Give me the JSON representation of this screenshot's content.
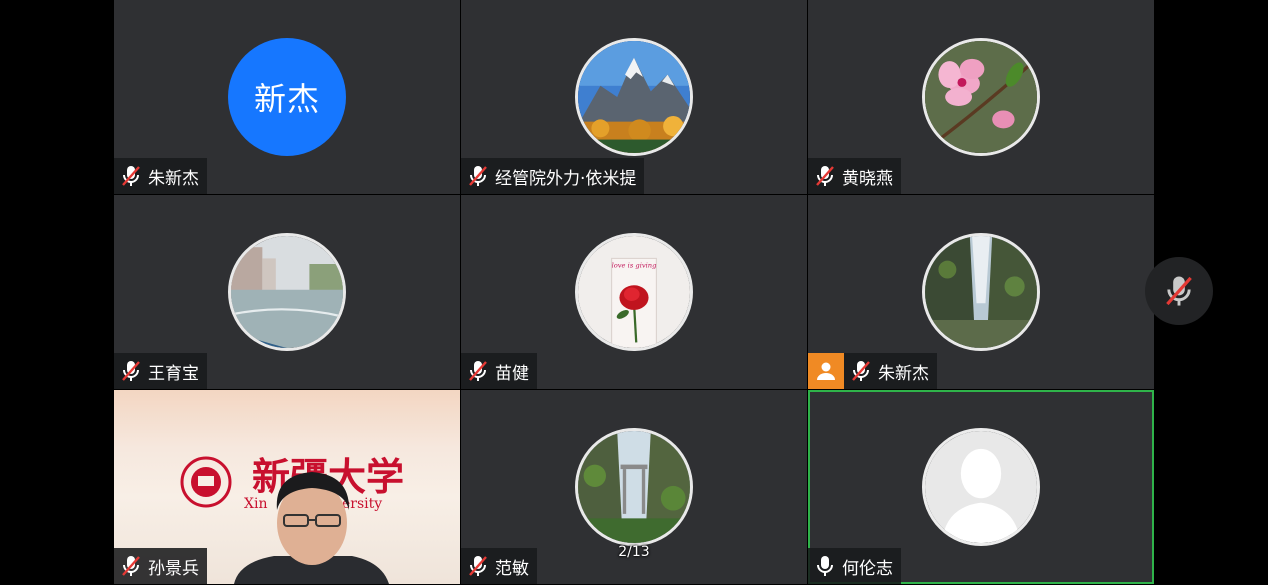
{
  "participants": [
    {
      "name": "朱新杰",
      "avatar_text": "新杰",
      "mic": "muted"
    },
    {
      "name": "经管院外力·依米提",
      "avatar": "mountain-photo",
      "mic": "muted"
    },
    {
      "name": "黄晓燕",
      "avatar": "flower-photo",
      "mic": "muted"
    },
    {
      "name": "王育宝",
      "avatar": "lake-photo",
      "mic": "muted"
    },
    {
      "name": "苗健",
      "avatar": "rose-photo",
      "mic": "muted"
    },
    {
      "name": "朱新杰",
      "avatar": "canyon-photo",
      "mic": "muted",
      "host": true
    },
    {
      "name": "孙景兵",
      "video": true,
      "mic": "muted"
    },
    {
      "name": "范敏",
      "avatar": "cliff-photo",
      "mic": "muted"
    },
    {
      "name": "何伦志",
      "avatar": "default-person",
      "mic": "on",
      "active_speaker": true
    }
  ],
  "video_banner": {
    "logo_text": "新疆大学",
    "english_fragment": "Xin",
    "english_fragment_2": "ersity"
  },
  "rose_text": "love is giving",
  "pagination": {
    "indicator": "2/13"
  },
  "colors": {
    "tile_bg": "#2f3033",
    "avatar_blue": "#1677ff",
    "active_border": "#2fb34a",
    "host_orange": "#f08a24",
    "mute_red": "#e53935"
  }
}
